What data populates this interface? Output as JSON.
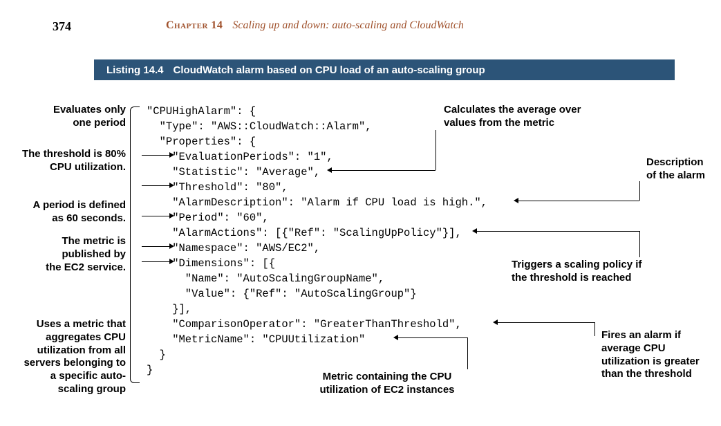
{
  "page_number": "374",
  "chapter_label": "Chapter 14",
  "chapter_title": "Scaling up and down: auto-scaling and CloudWatch",
  "listing_label": "Listing 14.4",
  "listing_title": "CloudWatch alarm based on CPU load of an auto-scaling group",
  "code": {
    "l1": "\"CPUHighAlarm\": {",
    "l2": "  \"Type\": \"AWS::CloudWatch::Alarm\",",
    "l3": "  \"Properties\": {",
    "l4": "    \"EvaluationPeriods\": \"1\",",
    "l5": "    \"Statistic\": \"Average\",",
    "l6": "    \"Threshold\": \"80\",",
    "l7": "    \"AlarmDescription\": \"Alarm if CPU load is high.\",",
    "l8": "    \"Period\": \"60\",",
    "l9": "    \"AlarmActions\": [{\"Ref\": \"ScalingUpPolicy\"}],",
    "l10": "    \"Namespace\": \"AWS/EC2\",",
    "l11": "    \"Dimensions\": [{",
    "l12": "      \"Name\": \"AutoScalingGroupName\",",
    "l13": "      \"Value\": {\"Ref\": \"AutoScalingGroup\"}",
    "l14": "    }],",
    "l15": "    \"ComparisonOperator\": \"GreaterThanThreshold\",",
    "l16": "    \"MetricName\": \"CPUUtilization\"",
    "l17": "  }",
    "l18": "}"
  },
  "annotations": {
    "eval_periods": "Evaluates only\none period",
    "threshold": "The threshold is 80%\nCPU utilization.",
    "period": "A period is defined\nas 60 seconds.",
    "namespace": "The metric is\npublished by\nthe EC2 service.",
    "dimensions": "Uses a metric that\naggregates CPU\nutilization from all\nservers belonging to\na specific auto-\nscaling group",
    "statistic": "Calculates the average over\nvalues from the metric",
    "description": "Description\nof the alarm",
    "actions": "Triggers a scaling policy if\nthe threshold is reached",
    "comparison": "Fires an alarm if\naverage CPU\nutilization is greater\nthan the threshold",
    "metric_name": "Metric containing the CPU\nutilization of EC2 instances"
  }
}
